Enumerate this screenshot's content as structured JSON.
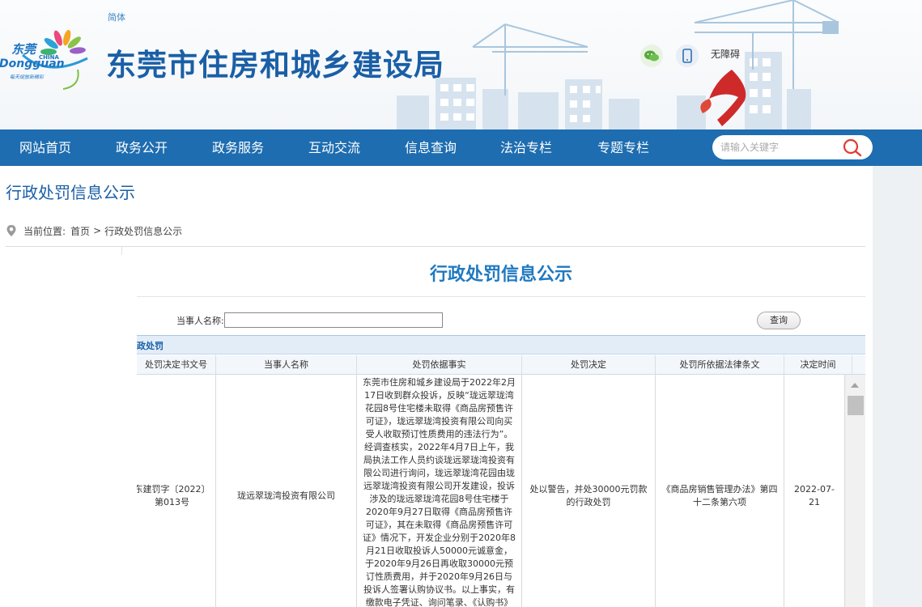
{
  "header": {
    "lang_link": "简体",
    "logo": {
      "cn": "东莞",
      "en": "Dongguan",
      "china": "CHINA",
      "slogan": "每天绽放新精彩"
    },
    "site_title": "东莞市住房和城乡建设局",
    "accessibility": "无障碍"
  },
  "nav": {
    "items": [
      "网站首页",
      "政务公开",
      "政务服务",
      "互动交流",
      "信息查询",
      "法治专栏",
      "专题专栏"
    ],
    "search_placeholder": "请输入关键字"
  },
  "page": {
    "heading": "行政处罚信息公示",
    "breadcrumb_label": "当前位置:",
    "breadcrumb_home": "首页",
    "breadcrumb_sep": ">",
    "breadcrumb_current": "行政处罚信息公示"
  },
  "content": {
    "title": "行政处罚信息公示",
    "query_label": "当事人名称:",
    "query_value": "",
    "query_button": "查询",
    "section_label": "政处罚",
    "columns": [
      "处罚决定书文号",
      "当事人名称",
      "处罚依据事实",
      "处罚决定",
      "处罚所依据法律条文",
      "决定时间"
    ],
    "rows": [
      {
        "doc_no": "东建罚字〔2022〕第013号",
        "party": "珑远翠珑湾投资有限公司",
        "facts": "东莞市住房和城乡建设局于2022年2月17日收到群众投诉，反映“珑远翠珑湾花园8号住宅楼未取得《商品房预售许可证》，珑远翠珑湾投资有限公司向买受人收取预订性质费用的违法行为”。经调查核实，2022年4月7日上午，我局执法工作人员约谈珑远翠珑湾投资有限公司进行询问，珑远翠珑湾花园由珑远翠珑湾投资有限公司开发建设，投诉涉及的珑远翠珑湾花园8号住宅楼于2020年9月27日取得《商品房预售许可证》，其在未取得《商品房预售许可证》情况下，开发企业分别于2020年8月21日收取投诉人50000元诚意金，于2020年9月26日再收取30000元预订性质费用，并于2020年9月26日与投诉人签署认购协议书。以上事实，有缴款电子凭证、询问笔录、《认购书》《收款收据》等资料为证",
        "decision": "处以警告，并处30000元罚款的行政处罚",
        "law": "《商品房销售管理办法》第四十二条第六项",
        "date": "2022-07-21"
      }
    ]
  },
  "colors": {
    "brand_blue": "#1a5fa6",
    "nav_bg": "#1e6db0",
    "title_blue": "#2079c0",
    "search_icon_red": "#e23a2e"
  },
  "icons": [
    "wechat-icon",
    "mobile-icon",
    "search-icon",
    "location-pin-icon",
    "scroll-up-arrow-icon"
  ]
}
